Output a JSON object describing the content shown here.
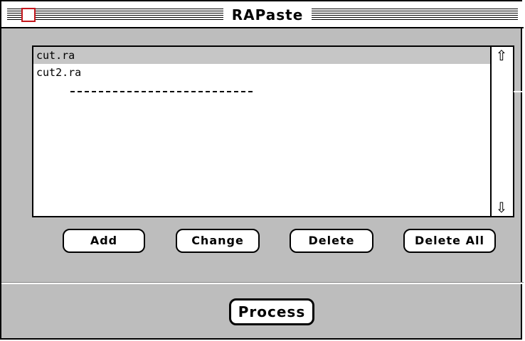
{
  "window": {
    "title": "RAPaste"
  },
  "list": {
    "items": [
      {
        "label": "cut.ra",
        "selected": true
      },
      {
        "label": "cut2.ra",
        "selected": false
      }
    ]
  },
  "buttons": {
    "add": "Add",
    "change": "Change",
    "delete": "Delete",
    "delete_all": "Delete All",
    "process": "Process"
  },
  "icons": {
    "scroll_up": "scroll-up-arrow-icon",
    "scroll_down": "scroll-down-arrow-icon",
    "close": "close-box-icon"
  },
  "colors": {
    "window_bg": "#bdbdbd",
    "selection": "#c6c6c6",
    "close_box": "#c4161c"
  }
}
